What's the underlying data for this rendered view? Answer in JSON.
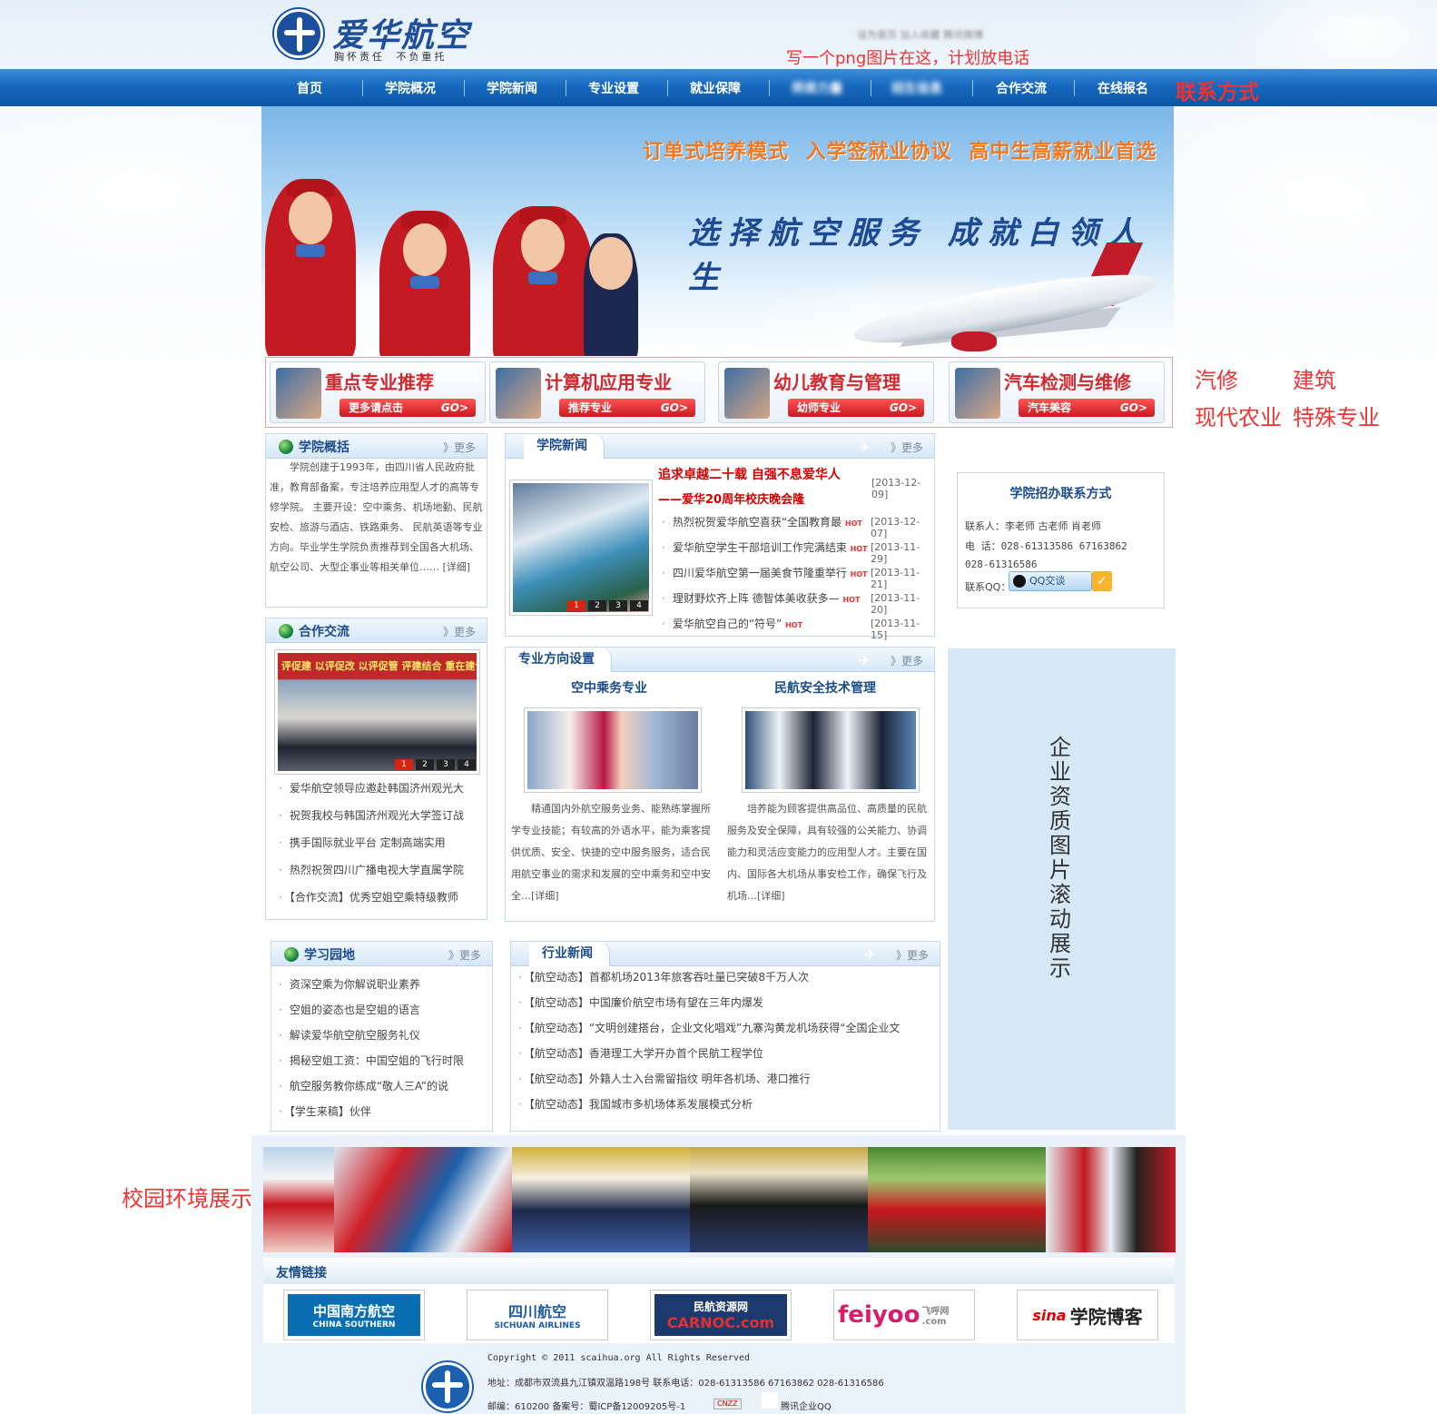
{
  "header": {
    "logo_name": "爱华航空",
    "logo_slogan": "胸怀责任 不负重托",
    "top_links_blurred": "设为首页 加入收藏 腾讯微博",
    "phone_note": "写一个png图片在这，计划放电话"
  },
  "nav": {
    "items": [
      "首页",
      "学院概况",
      "学院新闻",
      "专业设置",
      "就业保障",
      "师资力量",
      "招生信息",
      "合作交流",
      "在线报名"
    ],
    "contact_note": "联系方式"
  },
  "banner": {
    "tagline_top": "订单式培养模式 入学签就业协议 高中生高薪就业首选",
    "tagline_main": "选择航空服务 成就白领人生"
  },
  "promos": [
    {
      "title": "重点专业推荐",
      "button": "更多请点击",
      "go": "GO>"
    },
    {
      "title": "计算机应用专业",
      "button": "推荐专业",
      "go": "GO>"
    },
    {
      "title": "幼儿教育与管理",
      "button": "幼师专业",
      "go": "GO>"
    },
    {
      "title": "汽车检测与维修",
      "button": "汽车美容",
      "go": "GO>"
    }
  ],
  "side_notes": {
    "line1_a": "汽修",
    "line1_b": "建筑",
    "line2_a": "现代农业",
    "line2_b": "特殊专业"
  },
  "overview": {
    "title": "学院概括",
    "more": "》更多",
    "text": "学院创建于1993年，由四川省人民政府批准，教育部备案，专注培养应用型人才的高等专修学院。 主要开设：空中乘务、机场地勤、民航安检、旅游与酒店、铁路乘务、 民航英语等专业方向。毕业学生学院负责推荐到全国各大机场、航空公司、大型企事业等相关单位…… [详细]"
  },
  "news": {
    "title": "学院新闻",
    "more": "》更多",
    "headline_1": "追求卓越二十载 自强不息爱华人",
    "headline_2": "——爱华20周年校庆晚会隆",
    "headline_date": "[2013-12-09]",
    "hot_label": "HOT",
    "items": [
      {
        "text": "热烈祝贺爱华航空喜获“全国教育最",
        "date": "[2013-12-07]"
      },
      {
        "text": "爱华航空学生干部培训工作完满结束",
        "date": "[2013-11-29]"
      },
      {
        "text": "四川爱华航空第一届美食节隆重举行",
        "date": "[2013-11-21]"
      },
      {
        "text": "理财野炊齐上阵 德智体美收获多—",
        "date": "[2013-11-20]"
      },
      {
        "text": "爱华航空自己的“符号”",
        "date": "[2013-11-15]"
      }
    ],
    "pager": [
      "1",
      "2",
      "3",
      "4"
    ]
  },
  "contact": {
    "title": "学院招办联系方式",
    "people": "联系人：李老师  古老师  肖老师",
    "phone": "电  话：028-61313586 67163862",
    "phone2": "028-61316586",
    "qq_label": "联系QQ：",
    "qq_button": "QQ交谈"
  },
  "cooperation": {
    "title": "合作交流",
    "more": "》更多",
    "photo_banner": "评促建 以评促改 以评促管 评建结合 重在建设",
    "pager": [
      "1",
      "2",
      "3",
      "4"
    ],
    "items": [
      "爱华航空领导应邀赴韩国济州观光大",
      "祝贺我校与韩国济州观光大学签订战",
      "携手国际就业平台 定制高端实用",
      "热烈祝贺四川广播电视大学直属学院",
      "【合作交流】优秀空姐空乘特级教师"
    ]
  },
  "majors": {
    "title": "专业方向设置",
    "more": "》更多",
    "left_title": "空中乘务专业",
    "left_text": "精通国内外航空服务业务、能熟练掌握所学专业技能；有较高的外语水平，能为乘客提供优质、安全、快捷的空中服务服务，适合民用航空事业的需求和发展的空中乘务和空中安全…[详细]",
    "right_title": "民航安全技术管理",
    "right_text": "培养能为顾客提供高品位、高质量的民航服务及安全保障，具有较强的公关能力、协调能力和灵活应变能力的应用型人才。主要在国内、国际各大机场从事安检工作，确保飞行及机场…[详细]"
  },
  "qualification_note": "企业资质图片滚动展示",
  "study": {
    "title": "学习园地",
    "more": "》更多",
    "items": [
      "资深空乘为你解说职业素养",
      "空姐的姿态也是空姐的语言",
      "解读爱华航空航空服务礼仪",
      "揭秘空姐工资：中国空姐的飞行时限",
      "航空服务教你练成“敬人三A”的说",
      "【学生来稿】伙伴"
    ]
  },
  "industry": {
    "title": "行业新闻",
    "more": "》更多",
    "items": [
      "【航空动态】首都机场2013年旅客吞吐量已突破8千万人次",
      "【航空动态】中国廉价航空市场有望在三年内爆发",
      "【航空动态】“文明创建搭台，企业文化唱戏”九寨沟黄龙机场获得“全国企业文",
      "【航空动态】香港理工大学开办首个民航工程学位",
      "【航空动态】外籍人士入台需留指纹 明年各机场、港口推行",
      "【航空动态】我国城市多机场体系发展模式分析"
    ]
  },
  "campus_note": "校园环境展示",
  "links": {
    "title": "友情链接",
    "items": [
      {
        "label": "中国南方航空",
        "sub": "CHINA SOUTHERN"
      },
      {
        "label": "四川航空",
        "sub": "SICHUAN AIRLINES"
      },
      {
        "label": "民航资源网",
        "sub": "CARNOC.com"
      },
      {
        "label": "feiyoo",
        "sub": "飞呼网 .com"
      },
      {
        "label": "sina",
        "sub": "学院博客"
      }
    ]
  },
  "footer": {
    "copyright": "Copyright © 2011 scaihua.org All Rights Reserved",
    "address": "地址：成都市双流县九江镇双温路198号 联系电话：028-61313586 67163862 028-61316586",
    "icp": "邮编：610200 备案号：蜀ICP备12009205号-1",
    "cnzz": "CNZZ",
    "qq_link": "腾讯企业QQ"
  },
  "colors": {
    "nav_blue": "#0b56a4",
    "title_blue": "#1b4c8c",
    "promo_red": "#d2282e",
    "note_red": "#ee3333",
    "panel_blue": "#d6e7f6"
  }
}
